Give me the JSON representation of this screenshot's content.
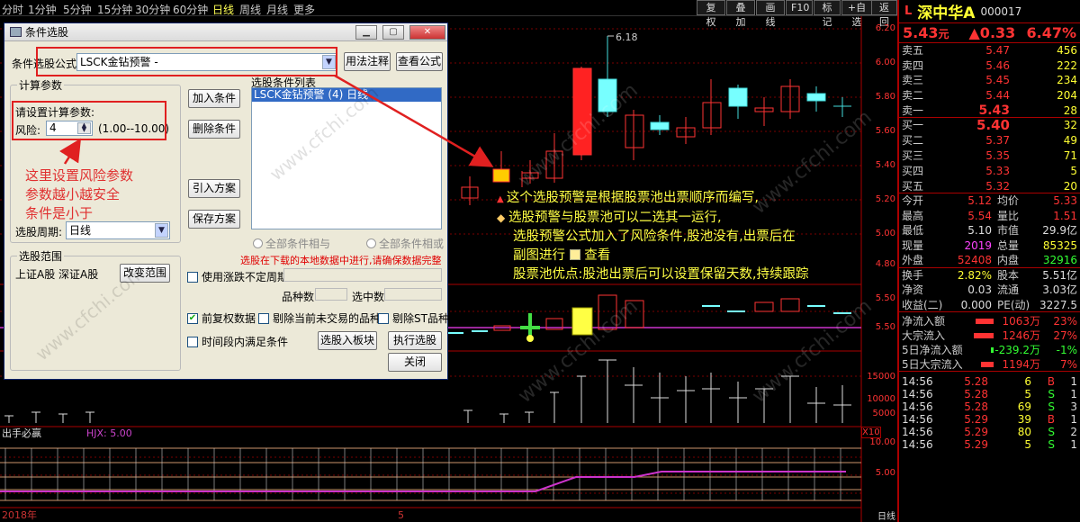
{
  "periods": [
    "分时",
    "1分钟",
    "5分钟",
    "15分钟",
    "30分钟",
    "60分钟",
    "日线",
    "周线",
    "月线",
    "更多"
  ],
  "active_period": "日线",
  "toolbar_buttons": [
    "复权",
    "叠加",
    "画线",
    "F10",
    "标记",
    "+自选",
    "返回"
  ],
  "chart": {
    "high_label": "6.18",
    "price_scale": [
      "6.20",
      "6.00",
      "5.80",
      "5.60",
      "5.40",
      "5.20",
      "5.00",
      "4.80"
    ],
    "sub_scale": [
      "5.50",
      "5.50"
    ],
    "vol_scale": [
      "15000",
      "10000",
      "5000",
      "X10"
    ],
    "ind_scale": [
      "10.00",
      "5.00"
    ],
    "indicator_name": "出手必赢",
    "indicator_line": "HJX: 5.00",
    "year_label": "2018年",
    "month_label": "5",
    "footer_label": "日线",
    "watermark": "www.cfchi.com"
  },
  "dialog": {
    "title": "条件选股",
    "formula_label": "条件选股公式",
    "formula_value": "LSCK金钻预警 -",
    "usage_button": "用法注释",
    "view_formula_button": "查看公式",
    "params_group": "计算参数",
    "params_prompt": "请设置计算参数:",
    "risk_label": "风险:",
    "risk_value": "4",
    "risk_range": "(1.00--10.00)",
    "period_label": "选股周期:",
    "period_value": "日线",
    "scope_group": "选股范围",
    "scope_value": "上证A股 深证A股",
    "change_scope_button": "改变范围",
    "add_cond_button": "加入条件",
    "del_cond_button": "删除条件",
    "import_button": "引入方案",
    "save_button": "保存方案",
    "list_label": "选股条件列表",
    "list_item": "LSCK金钻预警 (4) 日线",
    "radio_and": "全部条件相与",
    "radio_or": "全部条件相或",
    "local_warning": "选股在下载的本地数据中进行,请确保数据完整",
    "uncertain_period": "使用涨跌不定周期",
    "variety_count_label": "品种数",
    "selected_count_label": "选中数",
    "pre_adjust": "前复权数据",
    "exclude_untraded": "剔除当前未交易的品种",
    "exclude_st": "剔除ST品种",
    "period_satisfy": "时间段内满足条件",
    "to_block_button": "选股入板块",
    "run_button": "执行选股",
    "close_button": "关闭"
  },
  "annotation_red": [
    "这里设置风险参数",
    "参数越小越安全",
    "条件是小于"
  ],
  "annotation_yellow": [
    "这个选股预警是根据股票池出票顺序而编写,",
    "选股预警与股票池可以二选其一运行,",
    "选股预警公式加入了风险条件,股池没有,出票后在",
    "副图进行",
    "查看",
    "股票池优点:股池出票后可以设置保留天数,持续跟踪"
  ],
  "quote": {
    "prefix": "L",
    "name": "深中华A",
    "code": "000017",
    "price": "5.43",
    "unit": "元",
    "change": "▲0.33",
    "pct": "6.47%",
    "asks": [
      [
        "卖五",
        "5.47",
        "456"
      ],
      [
        "卖四",
        "5.46",
        "222"
      ],
      [
        "卖三",
        "5.45",
        "234"
      ],
      [
        "卖二",
        "5.44",
        "204"
      ],
      [
        "卖一",
        "5.43",
        "28"
      ]
    ],
    "cur_price": "5.40",
    "cur_vol": "32",
    "bids": [
      [
        "买二",
        "5.37",
        "49"
      ],
      [
        "买三",
        "5.35",
        "71"
      ],
      [
        "买四",
        "5.33",
        "5"
      ],
      [
        "买五",
        "5.32",
        "20"
      ]
    ],
    "bid1_label": "买一",
    "stats": [
      [
        "今开",
        "5.12",
        "均价",
        "5.33"
      ],
      [
        "最高",
        "5.54",
        "量比",
        "1.51"
      ],
      [
        "最低",
        "5.10",
        "市值",
        "29.9亿"
      ],
      [
        "现量",
        "2019",
        "总量",
        "85325"
      ],
      [
        "外盘",
        "52408",
        "内盘",
        "32916"
      ],
      [
        "换手",
        "2.82%",
        "股本",
        "5.51亿"
      ],
      [
        "净资",
        "0.03",
        "流通",
        "3.03亿"
      ],
      [
        "收益(二)",
        "0.000",
        "PE(动)",
        "3227.5"
      ]
    ],
    "flows": [
      [
        "净流入额",
        "1063万",
        "23%"
      ],
      [
        "大宗流入",
        "1246万",
        "27%"
      ],
      [
        "5日净流入额",
        "-239.2万",
        "-1%"
      ],
      [
        "5日大宗流入",
        "1194万",
        "7%"
      ]
    ],
    "ticks": [
      [
        "14:56",
        "5.28",
        "6",
        "B",
        "1"
      ],
      [
        "14:56",
        "5.28",
        "5",
        "S",
        "1"
      ],
      [
        "14:56",
        "5.28",
        "69",
        "S",
        "3"
      ],
      [
        "14:56",
        "5.29",
        "39",
        "B",
        "1"
      ],
      [
        "14:56",
        "5.29",
        "80",
        "S",
        "2"
      ],
      [
        "14:56",
        "5.29",
        "5",
        "S",
        "1"
      ]
    ]
  }
}
